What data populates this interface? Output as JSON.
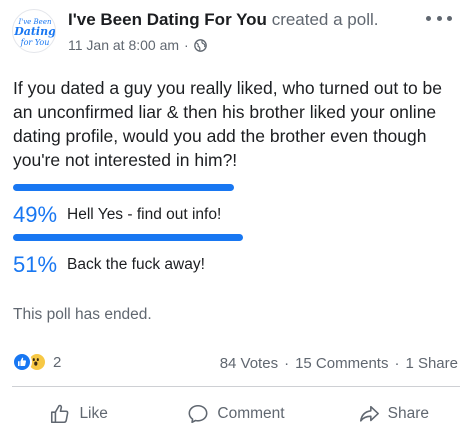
{
  "post": {
    "author": "I've Been Dating For You",
    "action": "created a poll.",
    "date": "11 Jan at 8:00 am",
    "meta_separator": "·",
    "question": "If you dated a guy you really liked, who turned out to be  an unconfirmed liar & then his brother liked your online dating profile, would you add the brother even though you're not interested in him?!",
    "avatar_logo": "I've Been Dating for You"
  },
  "poll": {
    "options": [
      {
        "percent": "49%",
        "label": "Hell Yes - find out info!",
        "fraction": 0.49
      },
      {
        "percent": "51%",
        "label": "Back the fuck away!",
        "fraction": 0.51
      }
    ],
    "status": "This poll has ended.",
    "bar_color": "#1877f2"
  },
  "engagement": {
    "reaction_count": "2",
    "reactions": [
      "like-icon",
      "wow-icon"
    ],
    "votes": "84 Votes",
    "comments": "15 Comments",
    "shares": "1 Share",
    "separator": "·"
  },
  "actions": {
    "like": "Like",
    "comment": "Comment",
    "share": "Share"
  }
}
